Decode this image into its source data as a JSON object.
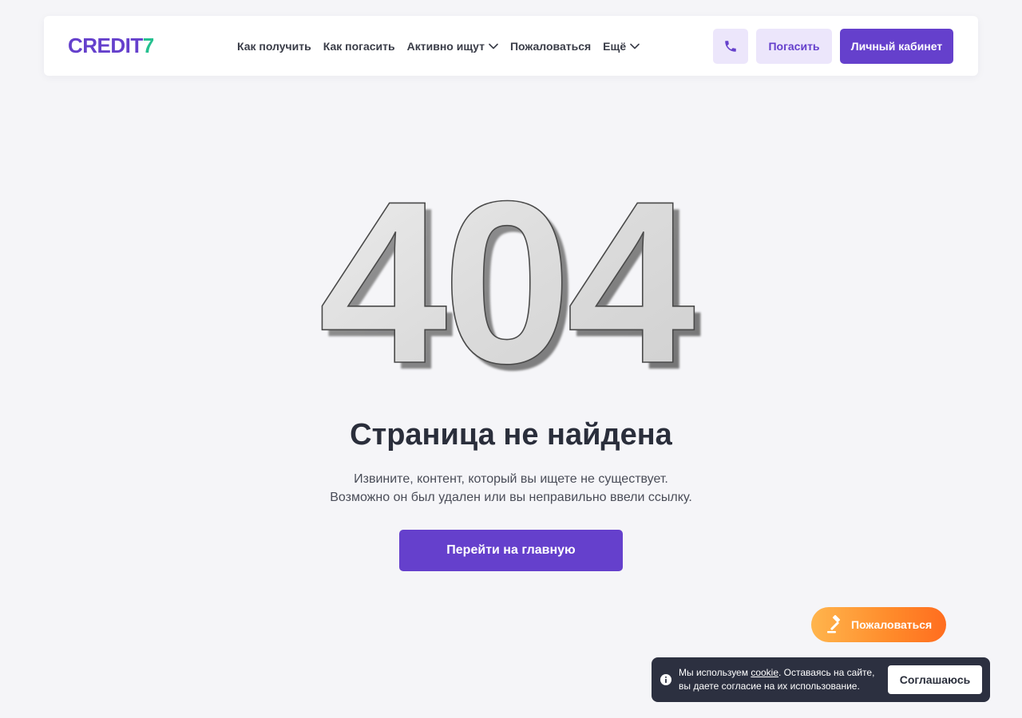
{
  "header": {
    "logo": {
      "word": "CREDIT",
      "digit": "7"
    },
    "nav": [
      {
        "label": "Как получить",
        "has_dropdown": false
      },
      {
        "label": "Как погасить",
        "has_dropdown": false
      },
      {
        "label": "Активно ищут",
        "has_dropdown": true
      },
      {
        "label": "Пожаловаться",
        "has_dropdown": false
      },
      {
        "label": "Ещё",
        "has_dropdown": true
      }
    ],
    "phone_icon": "phone-icon",
    "pay_label": "Погасить",
    "cabinet_label": "Личный кабинет"
  },
  "error": {
    "code": "404",
    "title": "Страница не найдена",
    "line1": "Извините, контент, который вы ищете не существует.",
    "line2": "Возможно он был удален или вы неправильно ввели ссылку.",
    "home_button": "Перейти на главную"
  },
  "complain_button": {
    "label": "Пожаловаться",
    "icon": "gavel-icon"
  },
  "cookie": {
    "icon": "info-icon",
    "text_before": "Мы используем ",
    "link": "cookie",
    "text_after": ". Оставаясь на сайте, вы даете согласие на их использование.",
    "accept": "Соглашаюсь"
  },
  "colors": {
    "brand": "#6540cc",
    "brand_light": "#ece6fb",
    "accent_green": "#25c08f",
    "orange": "#ff8a2a",
    "dark": "#2c3040",
    "background": "#f5f5f8"
  }
}
